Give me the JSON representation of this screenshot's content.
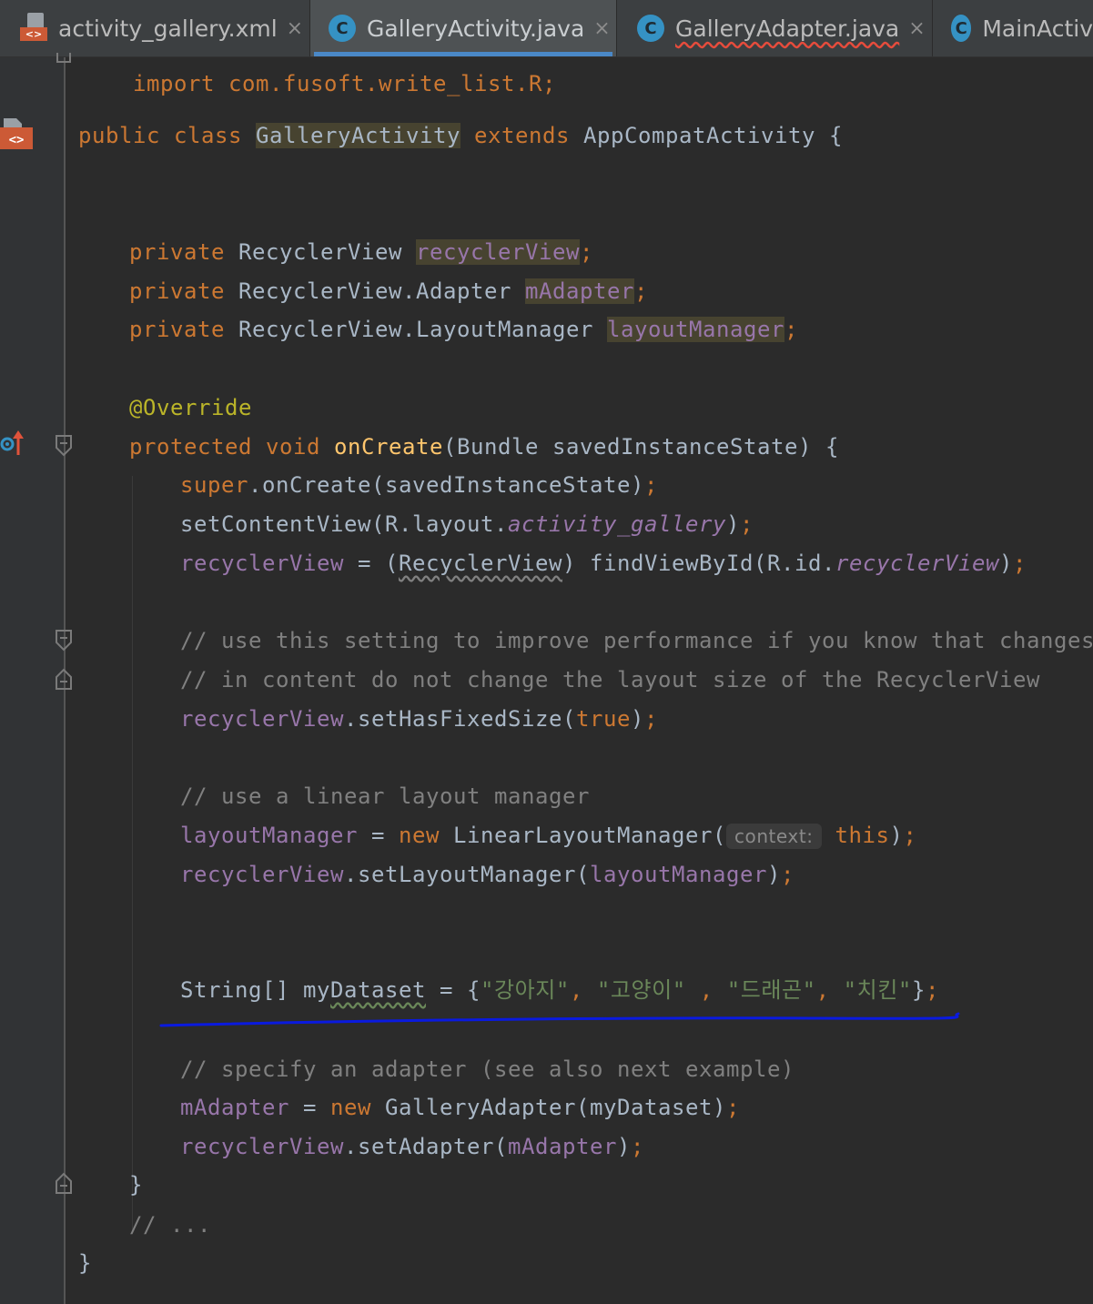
{
  "tabs": [
    {
      "label": "activity_gallery.xml",
      "icon": "xml-file-icon",
      "active": false,
      "close": "×"
    },
    {
      "label": "GalleryActivity.java",
      "icon": "java-class-icon",
      "active": true,
      "close": "×"
    },
    {
      "label": "GalleryAdapter.java",
      "icon": "java-class-icon",
      "active": false,
      "close": "×"
    },
    {
      "label": "MainActiv",
      "icon": "java-class-icon",
      "active": false,
      "close": ""
    }
  ],
  "class_icon_letter": "C",
  "code": {
    "import_line": "import com.fusoft.write_list.R;",
    "class_decl": {
      "public": "public",
      "class": "class",
      "name": "GalleryActivity",
      "extends": "extends",
      "parent": "AppCompatActivity",
      "brace": " {"
    },
    "fields": [
      {
        "modifier": "private",
        "type": "RecyclerView",
        "name": "recyclerView"
      },
      {
        "modifier": "private",
        "type": "RecyclerView.Adapter",
        "name": "mAdapter"
      },
      {
        "modifier": "private",
        "type": "RecyclerView.LayoutManager",
        "name": "layoutManager"
      }
    ],
    "annotation": "@Override",
    "method": {
      "protected": "protected",
      "void": "void",
      "name": "onCreate",
      "params": "(Bundle savedInstanceState) {"
    },
    "super_call": {
      "super": "super",
      "rest": ".onCreate(savedInstanceState)"
    },
    "set_content": {
      "pre": "setContentView(R.layout.",
      "res": "activity_gallery",
      "post": ")"
    },
    "find_view": {
      "field": "recyclerView",
      "eq": " = (",
      "cast": "RecyclerView",
      "mid": ") findViewById(R.id.",
      "res": "recyclerView",
      "post": ")"
    },
    "comment1": "// use this setting to improve performance if you know that changes",
    "comment2": "// in content do not change the layout size of the RecyclerView",
    "fixed_size": {
      "field": "recyclerView",
      "mid": ".setHasFixedSize(",
      "val": "true",
      "post": ")"
    },
    "comment3": "// use a linear layout manager",
    "layout_mgr": {
      "field": "layoutManager",
      "eq": " = ",
      "new": "new",
      "rest": " LinearLayoutManager(",
      "hint": "context:",
      "this": "this",
      "post": ")"
    },
    "set_layout": {
      "field": "recyclerView",
      "mid": ".setLayoutManager(",
      "arg": "layoutManager",
      "post": ")"
    },
    "dataset": {
      "type": "String[] ",
      "name_a": "my",
      "name_b": "Dataset",
      "eq": " = {",
      "items": [
        "\"강아지\"",
        "\"고양이\"",
        "\"드래곤\"",
        "\"치킨\""
      ],
      "close": "}"
    },
    "comment4": "// specify an adapter (see also next example)",
    "adapter_line": {
      "field": "mAdapter",
      "eq": " = ",
      "new": "new",
      "rest": " GalleryAdapter(myDataset)"
    },
    "set_adapter": {
      "field": "recyclerView",
      "mid": ".setAdapter(",
      "arg": "mAdapter",
      "post": ")"
    },
    "method_close": "}",
    "comment5": "// ...",
    "class_close": "}",
    "semicolon": ";",
    "comma": ", "
  },
  "annotation_color": "#0a1adf"
}
